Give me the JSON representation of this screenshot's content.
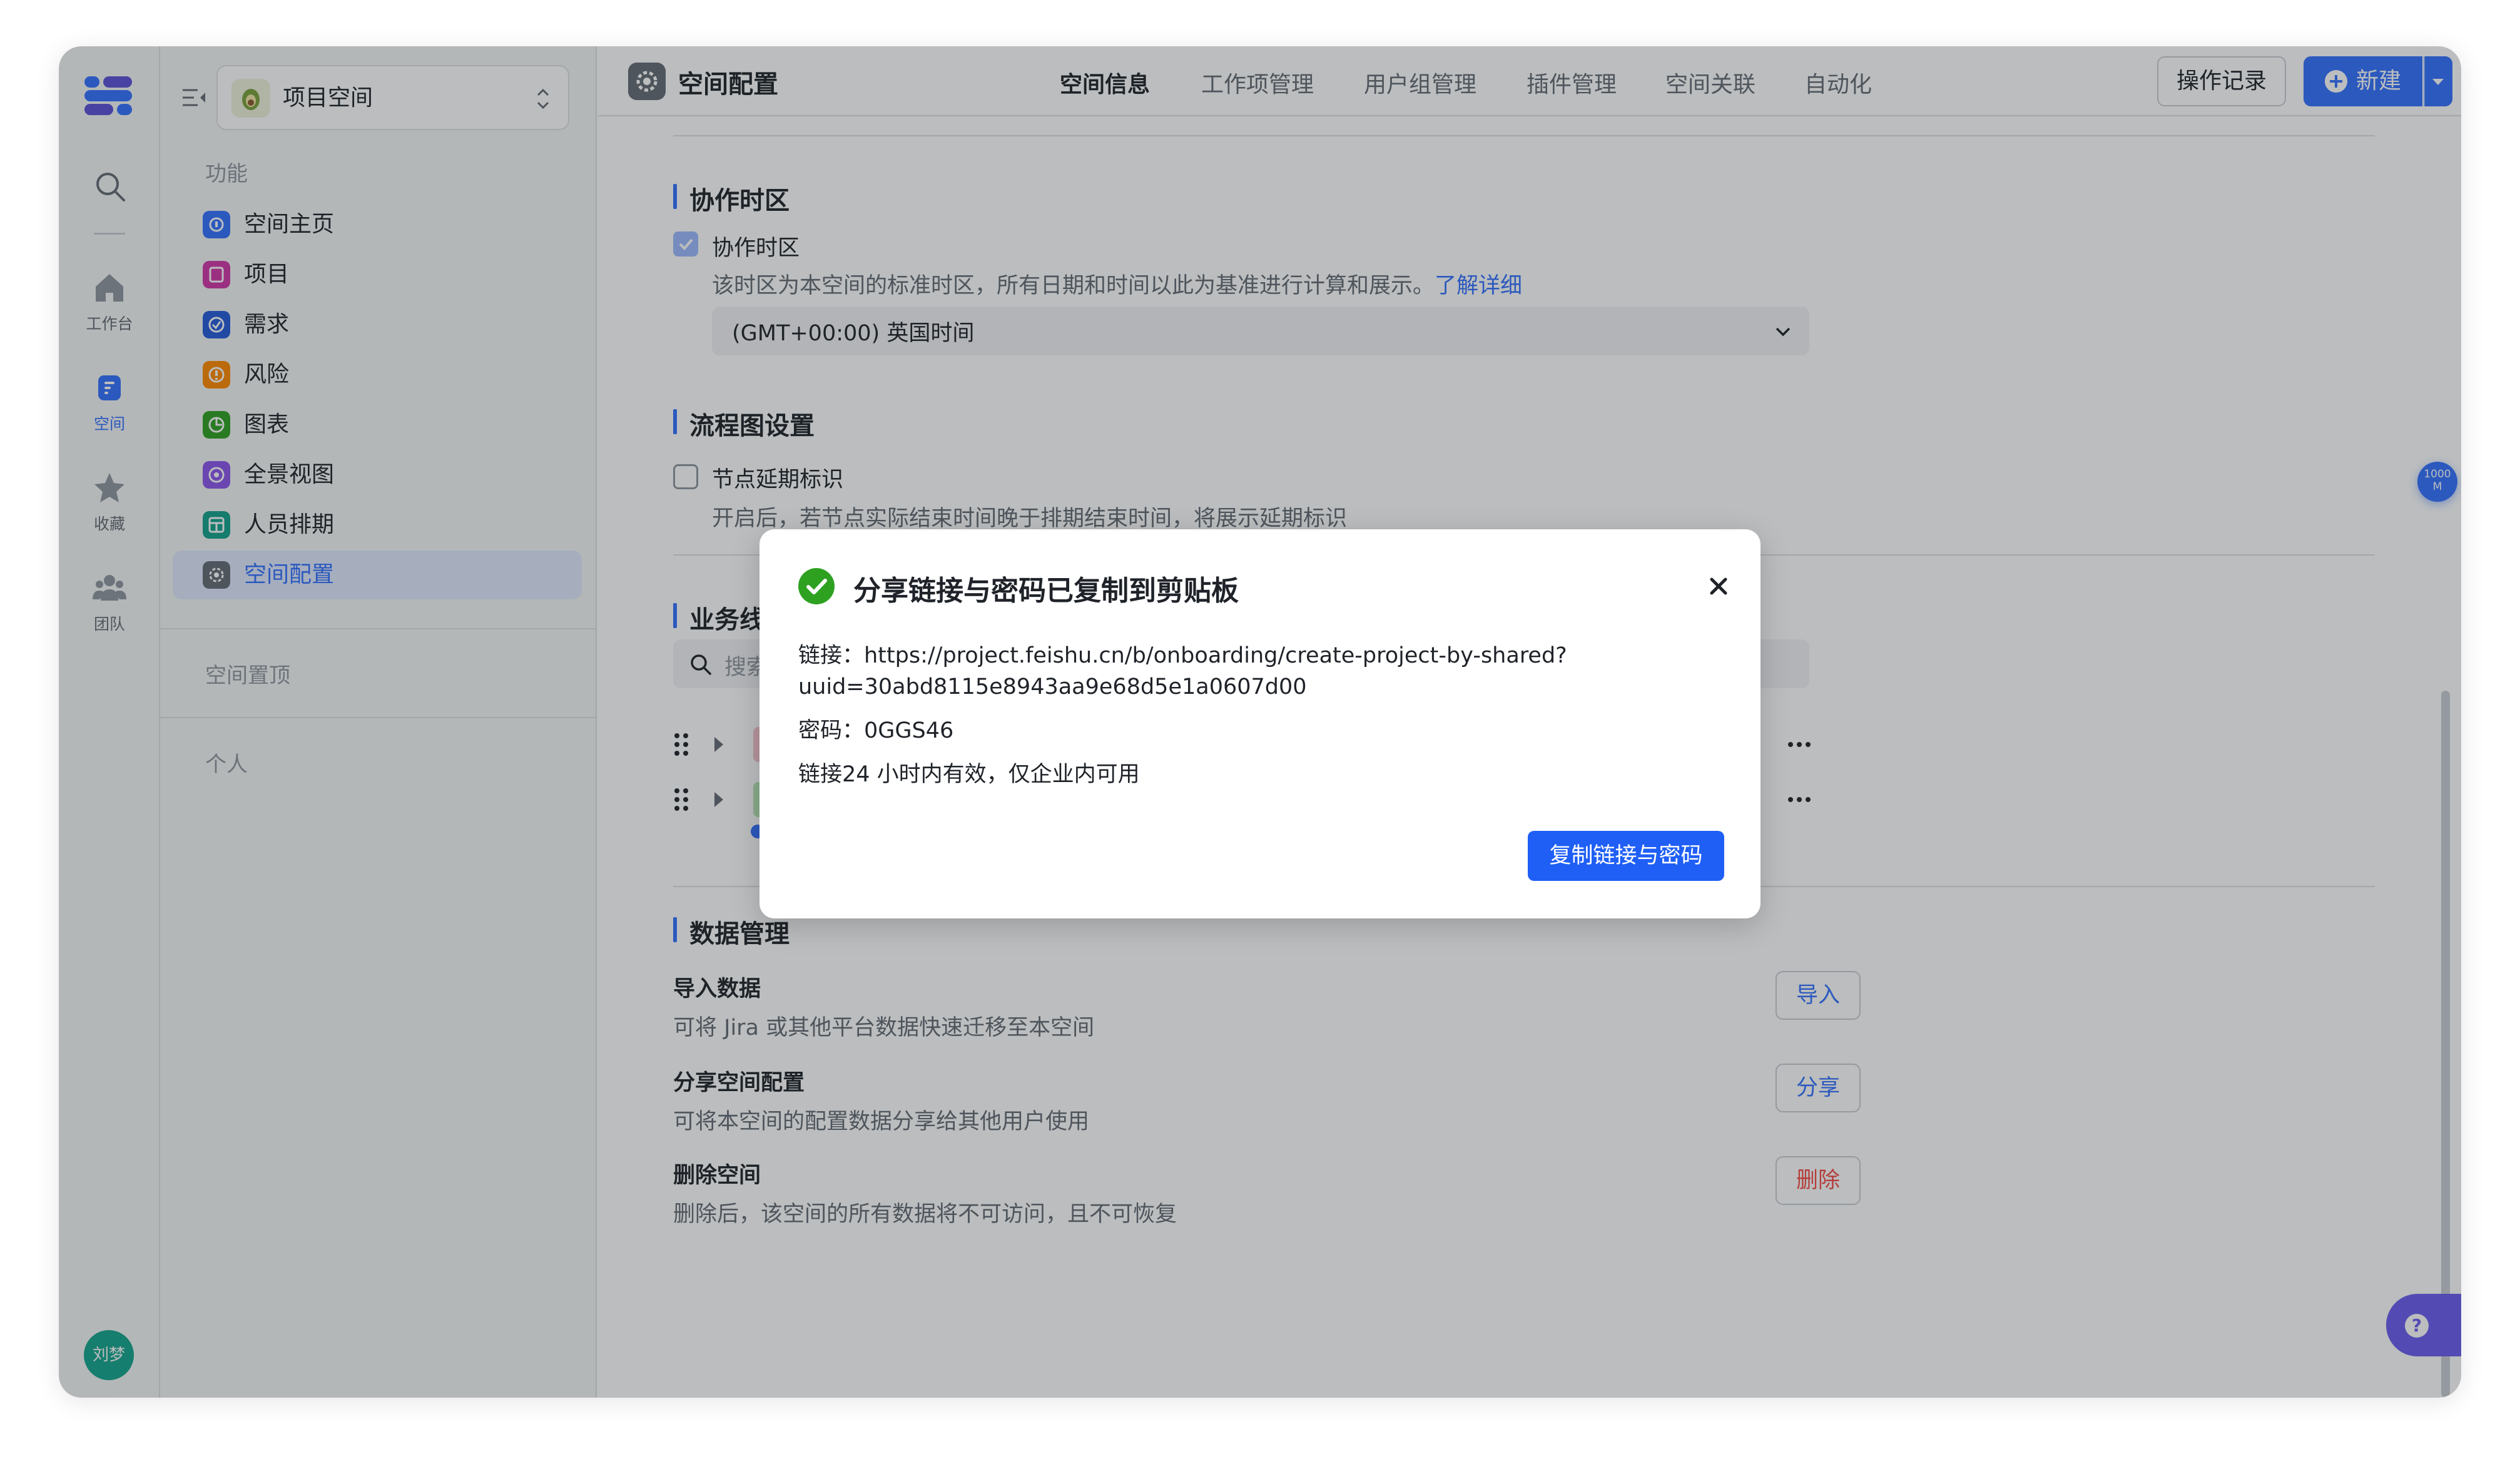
{
  "rail": {
    "items": [
      {
        "label": "工作台"
      },
      {
        "label": "空间"
      },
      {
        "label": "收藏"
      },
      {
        "label": "团队"
      }
    ],
    "avatar_text": "刘梦"
  },
  "sidebar": {
    "project_label": "项目空间",
    "section_features": "功能",
    "items": [
      {
        "label": "空间主页",
        "color": "#3370ff"
      },
      {
        "label": "项目",
        "color": "#d136a8"
      },
      {
        "label": "需求",
        "color": "#245bdb"
      },
      {
        "label": "风险",
        "color": "#ff8800"
      },
      {
        "label": "图表",
        "color": "#2ea121"
      },
      {
        "label": "全景视图",
        "color": "#8d55ed"
      },
      {
        "label": "人员排期",
        "color": "#14a28b"
      },
      {
        "label": "空间配置",
        "color": "#646a73"
      }
    ],
    "section_pinned": "空间置顶",
    "section_personal": "个人"
  },
  "header": {
    "title": "空间配置",
    "tabs": [
      "空间信息",
      "工作项管理",
      "用户组管理",
      "插件管理",
      "空间关联",
      "自动化"
    ],
    "active_tab": "空间信息",
    "log_button": "操作记录",
    "new_button": "新建"
  },
  "timezone": {
    "section_title": "协作时区",
    "checkbox_label": "协作时区",
    "description": "该时区为本空间的标准时区，所有日期和时间以此为基准进行计算和展示。",
    "learn_more": "了解详细",
    "selected": "(GMT+00:00) 英国时间"
  },
  "flowchart": {
    "section_title": "流程图设置",
    "checkbox_label": "节点延期标识",
    "description": "开启后，若节点实际结束时间晚于排期结束时间，将展示延期标识"
  },
  "business": {
    "section_title": "业务线",
    "search_placeholder": "搜索"
  },
  "data_mgmt": {
    "section_title": "数据管理",
    "rows": [
      {
        "title": "导入数据",
        "desc": "可将 Jira 或其他平台数据快速迁移至本空间",
        "button": "导入"
      },
      {
        "title": "分享空间配置",
        "desc": "可将本空间的配置数据分享给其他用户使用",
        "button": "分享"
      },
      {
        "title": "删除空间",
        "desc": "删除后，该空间的所有数据将不可访问，且不可恢复",
        "button": "删除"
      }
    ]
  },
  "float_badge": {
    "line1": "1000",
    "line2": "M"
  },
  "dialog": {
    "title": "分享链接与密码已复制到剪贴板",
    "link_line1": "链接：https://project.feishu.cn/b/onboarding/create-project-by-shared?",
    "link_line2": "uuid=30abd8115e8943aa9e68d5e1a0607d00",
    "password_line": "密码：0GGS46",
    "validity_line": "链接24 小时内有效，仅企业内可用",
    "copy_button": "复制链接与密码"
  },
  "colors": {
    "accent": "#3370ff",
    "success": "#2ea121",
    "danger": "#f54a45",
    "help": "#6b5cf0"
  }
}
